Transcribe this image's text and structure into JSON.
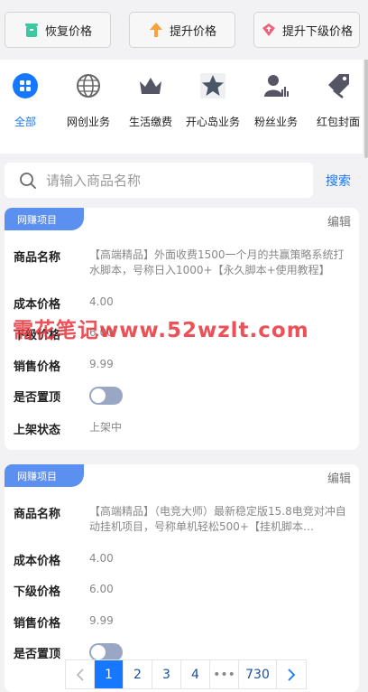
{
  "toolbar": {
    "restore_label": "恢复价格",
    "raise_label": "提升价格",
    "raise_sub_label": "提升下级价格"
  },
  "categories": [
    {
      "label": "全部",
      "icon": "grid-icon",
      "active": true
    },
    {
      "label": "网创业务",
      "icon": "globe-icon"
    },
    {
      "label": "生活缴费",
      "icon": "crown-icon"
    },
    {
      "label": "开心岛业务",
      "icon": "star-icon"
    },
    {
      "label": "粉丝业务",
      "icon": "person-chart-icon"
    },
    {
      "label": "红包封面",
      "icon": "tag-icon"
    }
  ],
  "search": {
    "placeholder": "请输入商品名称",
    "button_label": "搜索"
  },
  "field_labels": {
    "name": "商品名称",
    "cost": "成本价格",
    "sub": "下级价格",
    "sale": "销售价格",
    "pin": "是否置顶",
    "status": "上架状态"
  },
  "products": [
    {
      "tag": "网赚项目",
      "edit_label": "编辑",
      "name": "【高端精品】外面收费1500一个月的共赢策略系统打水脚本，号称日入1000+【永久脚本+使用教程】",
      "cost": "4.00",
      "sub": "6.00",
      "sale": "9.99",
      "pinned": false,
      "status": "上架中"
    },
    {
      "tag": "网赚项目",
      "edit_label": "编辑",
      "name": "【高端精品】（电竞大师）最新稳定版15.8电竞对冲自动挂机项目，号称单机轻松500+【挂机脚本…",
      "cost": "4.00",
      "sub": "6.00",
      "sale": "9.99",
      "pinned": false
    }
  ],
  "watermark": "需花笔记www.52wzlt.com",
  "pagination": {
    "pages": [
      "1",
      "2",
      "3",
      "4",
      "•••",
      "730"
    ],
    "current": "1"
  },
  "colors": {
    "accent": "#1677ff",
    "tag": "#5b8ff0"
  }
}
